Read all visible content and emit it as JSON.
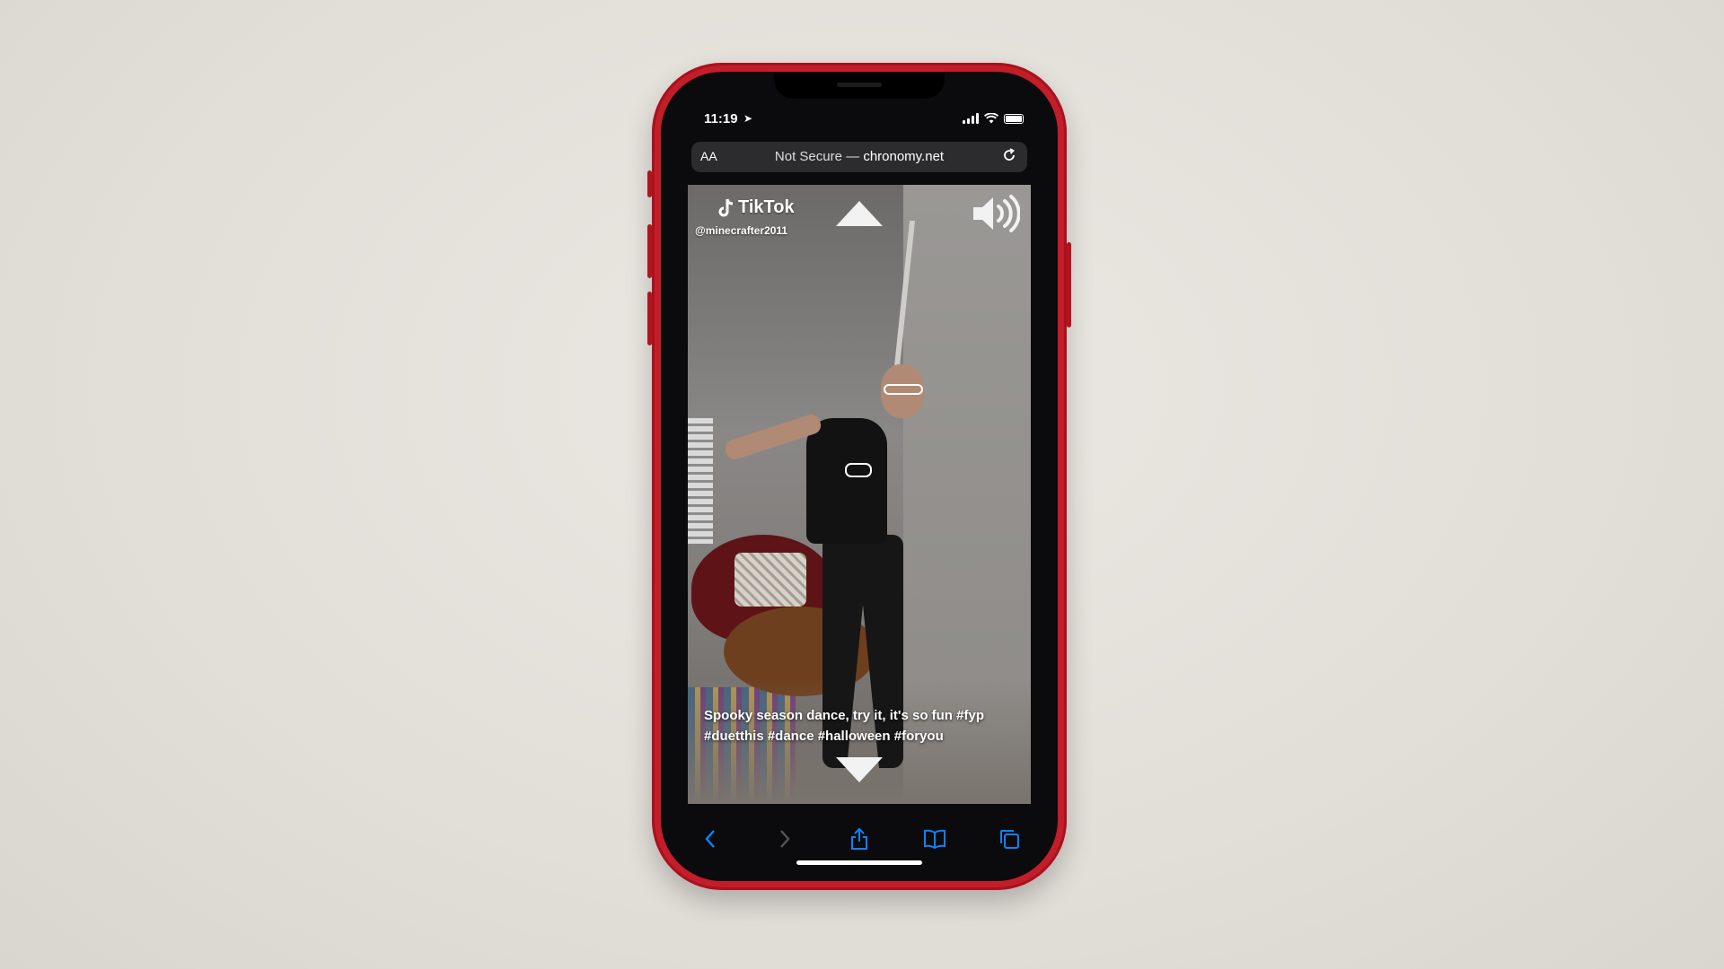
{
  "status_bar": {
    "time": "11:19",
    "location_glyph": "➤"
  },
  "browser": {
    "text_size_label": "AA",
    "security_label": "Not Secure —",
    "domain": "chronomy.net"
  },
  "tiktok": {
    "brand": "TikTok",
    "handle": "@minecrafter2011",
    "caption": "Spooky season dance, try it, it's so fun #fyp #duetthis #dance #halloween #foryou"
  },
  "toolbar": {
    "icons": [
      "back-icon",
      "forward-icon",
      "share-icon",
      "bookmarks-icon",
      "tabs-icon"
    ]
  },
  "colors": {
    "phone_red": "#c41d2a",
    "safari_blue": "#0a84ff",
    "disabled_gray": "#555"
  }
}
